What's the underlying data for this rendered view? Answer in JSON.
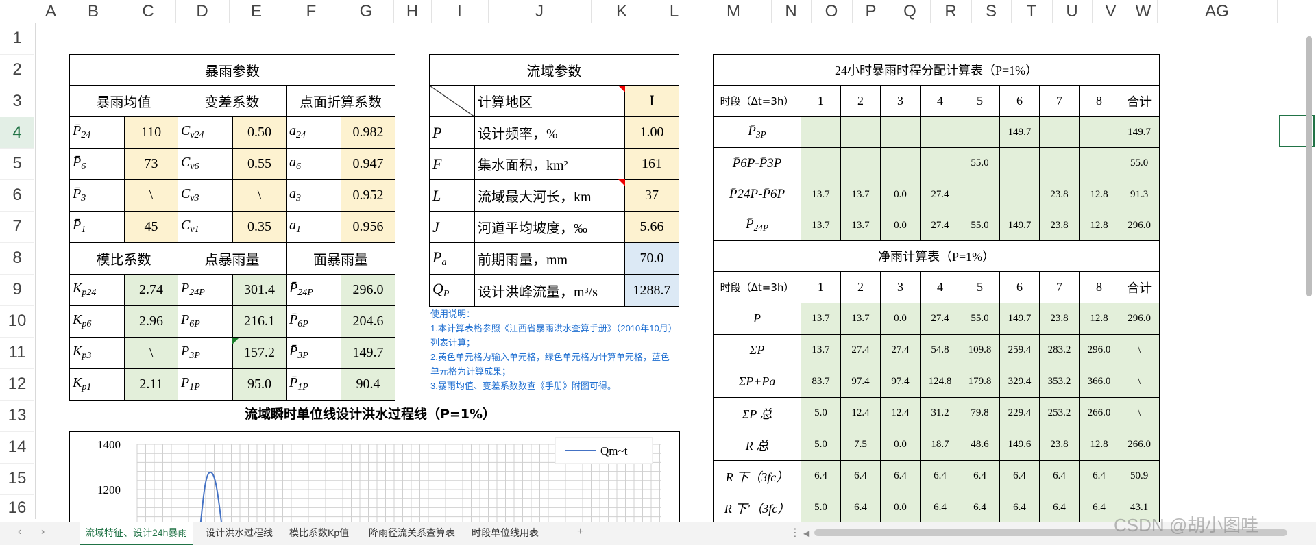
{
  "columns": [
    "A",
    "B",
    "C",
    "D",
    "E",
    "F",
    "G",
    "H",
    "I",
    "J",
    "K",
    "L",
    "M",
    "N",
    "O",
    "P",
    "Q",
    "R",
    "S",
    "T",
    "U",
    "V",
    "W",
    "AG"
  ],
  "rows": [
    "1",
    "2",
    "3",
    "4",
    "5",
    "6",
    "7",
    "8",
    "9",
    "10",
    "11",
    "12",
    "13",
    "14",
    "15",
    "16"
  ],
  "storm": {
    "title": "暴雨参数",
    "h1": "暴雨均值",
    "h2": "变差系数",
    "h3": "点面折算系数",
    "rows": [
      {
        "p": "P̄",
        "ps": "24",
        "pv": "110",
        "c": "C",
        "cs": "v24",
        "cv": "0.50",
        "a": "a",
        "as": "24",
        "av": "0.982"
      },
      {
        "p": "P̄",
        "ps": "6",
        "pv": "73",
        "c": "C",
        "cs": "v6",
        "cv": "0.55",
        "a": "a",
        "as": "6",
        "av": "0.947"
      },
      {
        "p": "P̄",
        "ps": "3",
        "pv": "\\",
        "c": "C",
        "cs": "v3",
        "cv": "\\",
        "a": "a",
        "as": "3",
        "av": "0.952"
      },
      {
        "p": "P̄",
        "ps": "1",
        "pv": "45",
        "c": "C",
        "cs": "v1",
        "cv": "0.35",
        "a": "a",
        "as": "1",
        "av": "0.956"
      }
    ],
    "h4": "模比系数",
    "h5": "点暴雨量",
    "h6": "面暴雨量",
    "rows2": [
      {
        "k": "K",
        "ks": "p24",
        "kv": "2.74",
        "p": "P",
        "ps": "24P",
        "pv": "301.4",
        "m": "P̄",
        "ms": "24P",
        "mv": "296.0"
      },
      {
        "k": "K",
        "ks": "p6",
        "kv": "2.96",
        "p": "P",
        "ps": "6P",
        "pv": "216.1",
        "m": "P̄",
        "ms": "6P",
        "mv": "204.6"
      },
      {
        "k": "K",
        "ks": "p3",
        "kv": "\\",
        "p": "P",
        "ps": "3P",
        "pv": "157.2",
        "m": "P̄",
        "ms": "3P",
        "mv": "149.7"
      },
      {
        "k": "K",
        "ks": "p1",
        "kv": "2.11",
        "p": "P",
        "ps": "1P",
        "pv": "95.0",
        "m": "P̄",
        "ms": "1P",
        "mv": "90.4"
      }
    ]
  },
  "basin": {
    "title": "流域参数",
    "rows": [
      {
        "sym": "",
        "label": "计算地区",
        "value": "Ⅰ"
      },
      {
        "sym": "P",
        "label": "设计频率，%",
        "value": "1.00"
      },
      {
        "sym": "F",
        "label": "集水面积，km²",
        "value": "161"
      },
      {
        "sym": "L",
        "label": "流域最大河长，km",
        "value": "37"
      },
      {
        "sym": "J",
        "label": "河道平均坡度，‰",
        "value": "5.66"
      },
      {
        "sym": "P",
        "symsub": "a",
        "label": "前期雨量，mm",
        "value": "70.0"
      },
      {
        "sym": "Q",
        "symsub": "P",
        "label": "设计洪峰流量，m³/s",
        "value": "1288.7"
      }
    ]
  },
  "notes": [
    "使用说明：",
    "1.本计算表格参照《江西省暴雨洪水查算手册》（2010年10月）列表计算；",
    " 2.黄色单元格为输入单元格，绿色单元格为计算单元格，蓝色单元格为计算成果；",
    "3.暴雨均值、变差系数数查《手册》附图可得。"
  ],
  "dist": {
    "title": "24小时暴雨时程分配计算表（P=1%）",
    "header": [
      "时段（Δt=3h）",
      "1",
      "2",
      "3",
      "4",
      "5",
      "6",
      "7",
      "8",
      "合计"
    ],
    "rows": [
      {
        "label": "P̄",
        "sub": "3P",
        "vals": [
          "",
          "",
          "",
          "",
          "",
          "149.7",
          "",
          "",
          "149.7"
        ]
      },
      {
        "label": "P̄6P-P̄3P",
        "sub": "",
        "vals": [
          "",
          "",
          "",
          "",
          "55.0",
          "",
          "",
          "",
          "55.0"
        ]
      },
      {
        "label": "P̄24P-P̄6P",
        "sub": "",
        "vals": [
          "13.7",
          "13.7",
          "0.0",
          "27.4",
          "",
          "",
          "23.8",
          "12.8",
          "91.3"
        ]
      },
      {
        "label": "P̄",
        "sub": "24P",
        "vals": [
          "13.7",
          "13.7",
          "0.0",
          "27.4",
          "55.0",
          "149.7",
          "23.8",
          "12.8",
          "296.0"
        ]
      }
    ]
  },
  "net": {
    "title": "净雨计算表（P=1%）",
    "header": [
      "时段（Δt=3h）",
      "1",
      "2",
      "3",
      "4",
      "5",
      "6",
      "7",
      "8",
      "合计"
    ],
    "rows": [
      {
        "label": "P",
        "vals": [
          "13.7",
          "13.7",
          "0.0",
          "27.4",
          "55.0",
          "149.7",
          "23.8",
          "12.8",
          "296.0"
        ]
      },
      {
        "label": "ΣP",
        "vals": [
          "13.7",
          "27.4",
          "27.4",
          "54.8",
          "109.8",
          "259.4",
          "283.2",
          "296.0",
          "\\"
        ]
      },
      {
        "label": "ΣP+Pa",
        "vals": [
          "83.7",
          "97.4",
          "97.4",
          "124.8",
          "179.8",
          "329.4",
          "353.2",
          "366.0",
          "\\"
        ]
      },
      {
        "label": "ΣP 总",
        "vals": [
          "5.0",
          "12.4",
          "12.4",
          "31.2",
          "79.8",
          "229.4",
          "253.2",
          "266.0",
          "\\"
        ]
      },
      {
        "label": "R 总",
        "vals": [
          "5.0",
          "7.5",
          "0.0",
          "18.7",
          "48.6",
          "149.6",
          "23.8",
          "12.8",
          "266.0"
        ]
      },
      {
        "label": "R 下（3fc）",
        "vals": [
          "6.4",
          "6.4",
          "6.4",
          "6.4",
          "6.4",
          "6.4",
          "6.4",
          "6.4",
          "50.9"
        ]
      },
      {
        "label": "R 下′（3fc）",
        "vals": [
          "5.0",
          "6.4",
          "0.0",
          "6.4",
          "6.4",
          "6.4",
          "6.4",
          "6.4",
          "43.1"
        ]
      }
    ]
  },
  "chart_data": {
    "type": "line",
    "title": "流域瞬时单位线设计洪水过程线（P=1%）",
    "legend": "Qm~t",
    "yticks": [
      "1400",
      "1200"
    ],
    "ylim": [
      1000,
      1400
    ],
    "series": [
      {
        "name": "Qm~t",
        "peak": 1288.7
      }
    ]
  },
  "tabs": [
    "流域特征、设计24h暴雨",
    "设计洪水过程线",
    "模比系数Kp值",
    "降雨径流关系查算表",
    "时段单位线用表"
  ],
  "watermark": "CSDN @胡小图哇"
}
